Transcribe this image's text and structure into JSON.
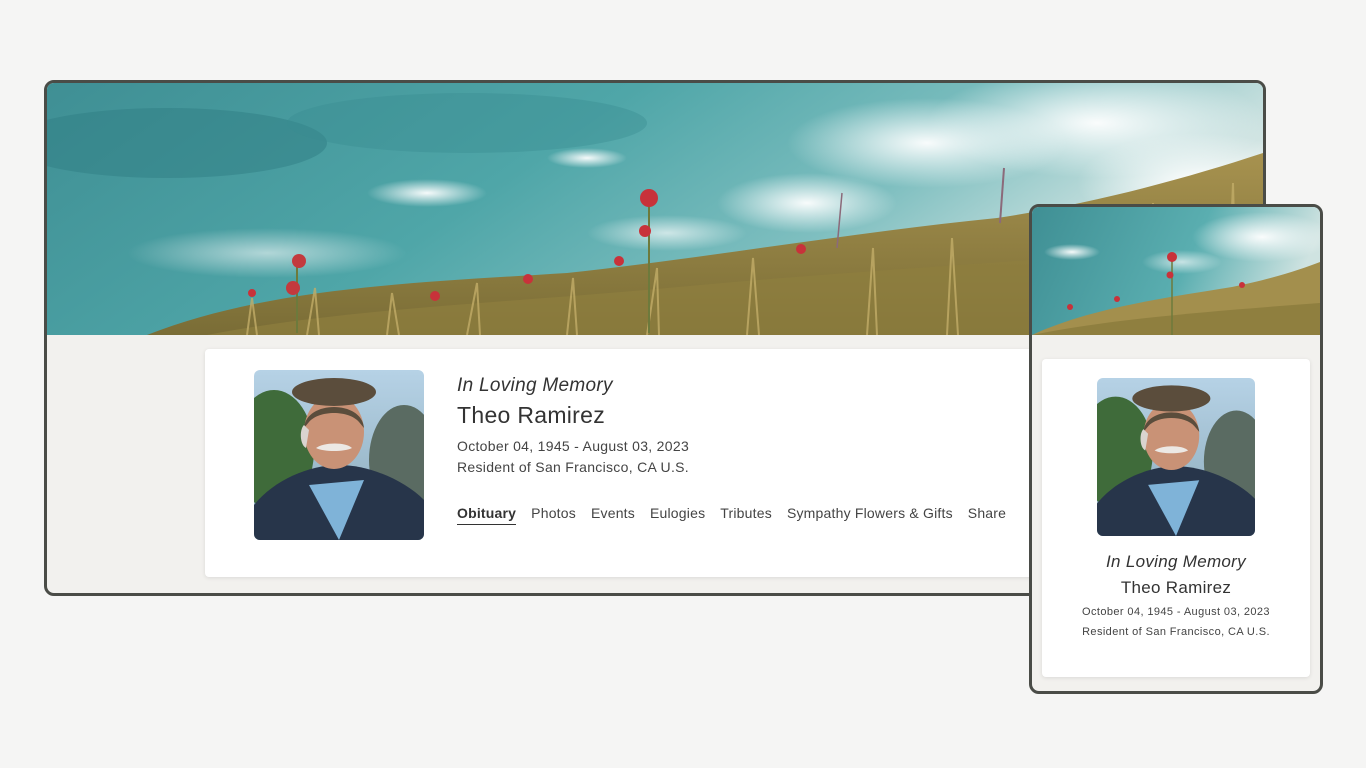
{
  "colors": {
    "page_background": "#f5f5f4",
    "frame_border": "#4a4c47",
    "card_background": "#ffffff",
    "section_background": "#f2f1ee",
    "text": "#333333"
  },
  "memorial": {
    "heading": "In Loving Memory",
    "name": "Theo Ramirez",
    "dates": "October 04, 1945 - August 03, 2023",
    "residence": "Resident of San Francisco, CA U.S."
  },
  "nav": {
    "items": [
      {
        "label": "Obituary",
        "active": true
      },
      {
        "label": "Photos",
        "active": false
      },
      {
        "label": "Events",
        "active": false
      },
      {
        "label": "Eulogies",
        "active": false
      },
      {
        "label": "Tributes",
        "active": false
      },
      {
        "label": "Sympathy Flowers & Gifts",
        "active": false
      },
      {
        "label": "Share",
        "active": false
      }
    ]
  },
  "images": {
    "banner": "ocean-cliff-wildflowers-banner",
    "portrait": "elderly-man-portrait"
  }
}
